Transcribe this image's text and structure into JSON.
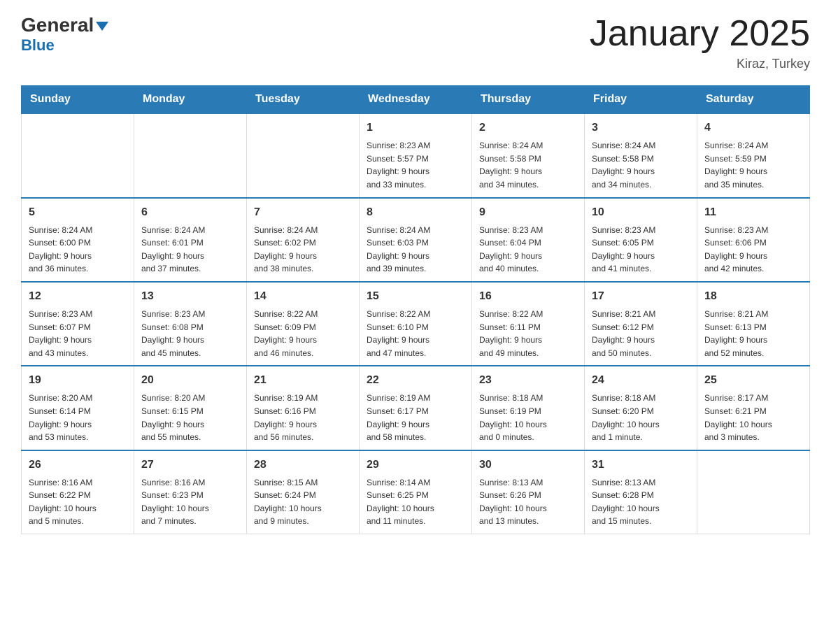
{
  "header": {
    "logo_text_general": "General",
    "logo_text_blue": "Blue",
    "month_title": "January 2025",
    "location": "Kiraz, Turkey"
  },
  "days_of_week": [
    "Sunday",
    "Monday",
    "Tuesday",
    "Wednesday",
    "Thursday",
    "Friday",
    "Saturday"
  ],
  "weeks": [
    [
      {
        "day": "",
        "info": ""
      },
      {
        "day": "",
        "info": ""
      },
      {
        "day": "",
        "info": ""
      },
      {
        "day": "1",
        "info": "Sunrise: 8:23 AM\nSunset: 5:57 PM\nDaylight: 9 hours\nand 33 minutes."
      },
      {
        "day": "2",
        "info": "Sunrise: 8:24 AM\nSunset: 5:58 PM\nDaylight: 9 hours\nand 34 minutes."
      },
      {
        "day": "3",
        "info": "Sunrise: 8:24 AM\nSunset: 5:58 PM\nDaylight: 9 hours\nand 34 minutes."
      },
      {
        "day": "4",
        "info": "Sunrise: 8:24 AM\nSunset: 5:59 PM\nDaylight: 9 hours\nand 35 minutes."
      }
    ],
    [
      {
        "day": "5",
        "info": "Sunrise: 8:24 AM\nSunset: 6:00 PM\nDaylight: 9 hours\nand 36 minutes."
      },
      {
        "day": "6",
        "info": "Sunrise: 8:24 AM\nSunset: 6:01 PM\nDaylight: 9 hours\nand 37 minutes."
      },
      {
        "day": "7",
        "info": "Sunrise: 8:24 AM\nSunset: 6:02 PM\nDaylight: 9 hours\nand 38 minutes."
      },
      {
        "day": "8",
        "info": "Sunrise: 8:24 AM\nSunset: 6:03 PM\nDaylight: 9 hours\nand 39 minutes."
      },
      {
        "day": "9",
        "info": "Sunrise: 8:23 AM\nSunset: 6:04 PM\nDaylight: 9 hours\nand 40 minutes."
      },
      {
        "day": "10",
        "info": "Sunrise: 8:23 AM\nSunset: 6:05 PM\nDaylight: 9 hours\nand 41 minutes."
      },
      {
        "day": "11",
        "info": "Sunrise: 8:23 AM\nSunset: 6:06 PM\nDaylight: 9 hours\nand 42 minutes."
      }
    ],
    [
      {
        "day": "12",
        "info": "Sunrise: 8:23 AM\nSunset: 6:07 PM\nDaylight: 9 hours\nand 43 minutes."
      },
      {
        "day": "13",
        "info": "Sunrise: 8:23 AM\nSunset: 6:08 PM\nDaylight: 9 hours\nand 45 minutes."
      },
      {
        "day": "14",
        "info": "Sunrise: 8:22 AM\nSunset: 6:09 PM\nDaylight: 9 hours\nand 46 minutes."
      },
      {
        "day": "15",
        "info": "Sunrise: 8:22 AM\nSunset: 6:10 PM\nDaylight: 9 hours\nand 47 minutes."
      },
      {
        "day": "16",
        "info": "Sunrise: 8:22 AM\nSunset: 6:11 PM\nDaylight: 9 hours\nand 49 minutes."
      },
      {
        "day": "17",
        "info": "Sunrise: 8:21 AM\nSunset: 6:12 PM\nDaylight: 9 hours\nand 50 minutes."
      },
      {
        "day": "18",
        "info": "Sunrise: 8:21 AM\nSunset: 6:13 PM\nDaylight: 9 hours\nand 52 minutes."
      }
    ],
    [
      {
        "day": "19",
        "info": "Sunrise: 8:20 AM\nSunset: 6:14 PM\nDaylight: 9 hours\nand 53 minutes."
      },
      {
        "day": "20",
        "info": "Sunrise: 8:20 AM\nSunset: 6:15 PM\nDaylight: 9 hours\nand 55 minutes."
      },
      {
        "day": "21",
        "info": "Sunrise: 8:19 AM\nSunset: 6:16 PM\nDaylight: 9 hours\nand 56 minutes."
      },
      {
        "day": "22",
        "info": "Sunrise: 8:19 AM\nSunset: 6:17 PM\nDaylight: 9 hours\nand 58 minutes."
      },
      {
        "day": "23",
        "info": "Sunrise: 8:18 AM\nSunset: 6:19 PM\nDaylight: 10 hours\nand 0 minutes."
      },
      {
        "day": "24",
        "info": "Sunrise: 8:18 AM\nSunset: 6:20 PM\nDaylight: 10 hours\nand 1 minute."
      },
      {
        "day": "25",
        "info": "Sunrise: 8:17 AM\nSunset: 6:21 PM\nDaylight: 10 hours\nand 3 minutes."
      }
    ],
    [
      {
        "day": "26",
        "info": "Sunrise: 8:16 AM\nSunset: 6:22 PM\nDaylight: 10 hours\nand 5 minutes."
      },
      {
        "day": "27",
        "info": "Sunrise: 8:16 AM\nSunset: 6:23 PM\nDaylight: 10 hours\nand 7 minutes."
      },
      {
        "day": "28",
        "info": "Sunrise: 8:15 AM\nSunset: 6:24 PM\nDaylight: 10 hours\nand 9 minutes."
      },
      {
        "day": "29",
        "info": "Sunrise: 8:14 AM\nSunset: 6:25 PM\nDaylight: 10 hours\nand 11 minutes."
      },
      {
        "day": "30",
        "info": "Sunrise: 8:13 AM\nSunset: 6:26 PM\nDaylight: 10 hours\nand 13 minutes."
      },
      {
        "day": "31",
        "info": "Sunrise: 8:13 AM\nSunset: 6:28 PM\nDaylight: 10 hours\nand 15 minutes."
      },
      {
        "day": "",
        "info": ""
      }
    ]
  ]
}
